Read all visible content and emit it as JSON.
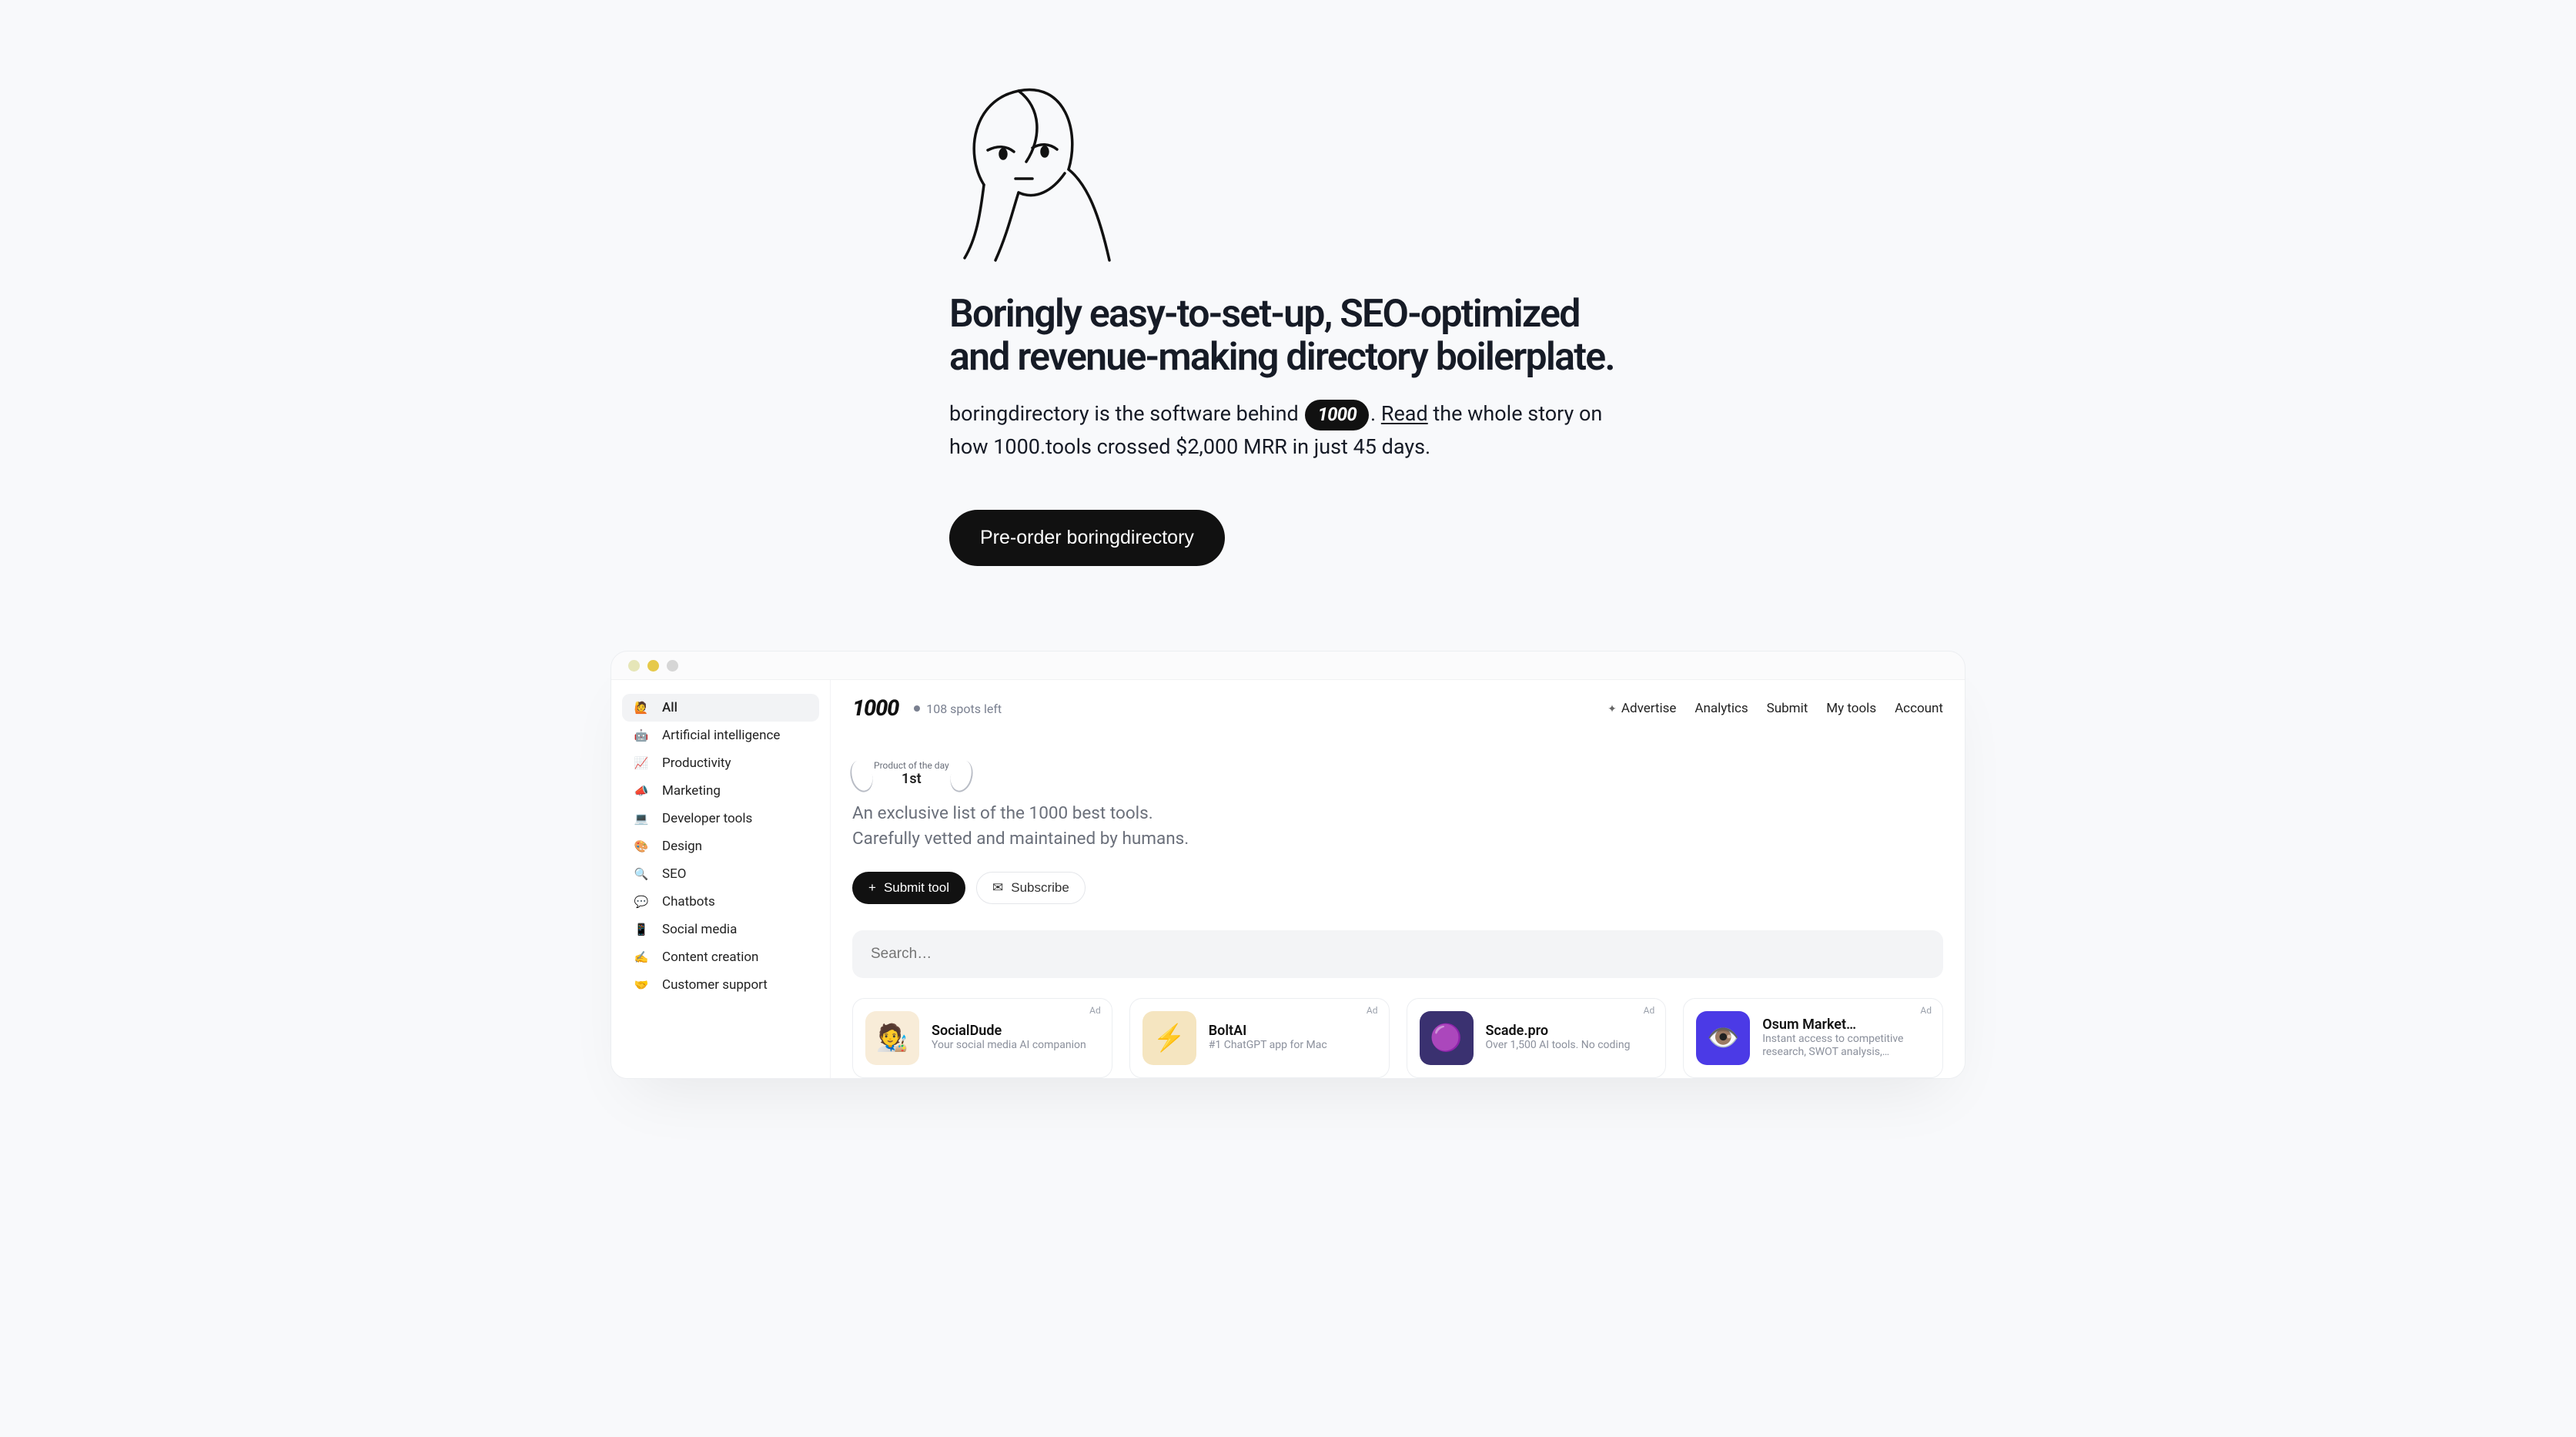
{
  "hero": {
    "headline": "Boringly easy-to-set-up, SEO-optimized and revenue-making directory boilerplate.",
    "sub_prefix": "boringdirectory is the software behind ",
    "pill_label": "1000",
    "sub_period": ". ",
    "read_link": "Read",
    "sub_rest": " the whole story on how 1000.tools crossed $2,000 MRR in just 45 days.",
    "cta": "Pre-order boringdirectory"
  },
  "app": {
    "sidebar": [
      {
        "icon": "🙋",
        "label": "All",
        "active": true
      },
      {
        "icon": "🤖",
        "label": "Artificial intelligence"
      },
      {
        "icon": "📈",
        "label": "Productivity"
      },
      {
        "icon": "📣",
        "label": "Marketing"
      },
      {
        "icon": "💻",
        "label": "Developer tools"
      },
      {
        "icon": "🎨",
        "label": "Design"
      },
      {
        "icon": "🔍",
        "label": "SEO"
      },
      {
        "icon": "💬",
        "label": "Chatbots"
      },
      {
        "icon": "📱",
        "label": "Social media"
      },
      {
        "icon": "✍️",
        "label": "Content creation"
      },
      {
        "icon": "🤝",
        "label": "Customer support"
      }
    ],
    "logo": "1000",
    "spots": "108 spots left",
    "toplinks": {
      "advertise": "Advertise",
      "analytics": "Analytics",
      "submit": "Submit",
      "my_tools": "My tools",
      "account": "Account"
    },
    "laurel_small": "Product of the day",
    "laurel_big": "1st",
    "hero_line1": "An exclusive list of the 1000 best tools.",
    "hero_line2": "Carefully vetted and maintained by humans.",
    "submit_btn": "Submit tool",
    "subscribe_btn": "Subscribe",
    "search_placeholder": "Search…",
    "ad_label": "Ad",
    "cards": [
      {
        "title": "SocialDude",
        "desc": "Your social media AI companion",
        "thumb_bg": "#f8ecd8",
        "thumb": "🧑‍🎨"
      },
      {
        "title": "BoltAI",
        "desc": "#1 ChatGPT app for Mac",
        "thumb_bg": "#f5e5c0",
        "thumb": "⚡"
      },
      {
        "title": "Scade.pro",
        "desc": "Over 1,500 AI tools. No coding",
        "thumb_bg": "#3a3170",
        "thumb": "🟣"
      },
      {
        "title": "Osum Market…",
        "desc": "Instant access to competitive research, SWOT analysis,…",
        "thumb_bg": "#4b3ae6",
        "thumb": "👁️"
      }
    ]
  }
}
